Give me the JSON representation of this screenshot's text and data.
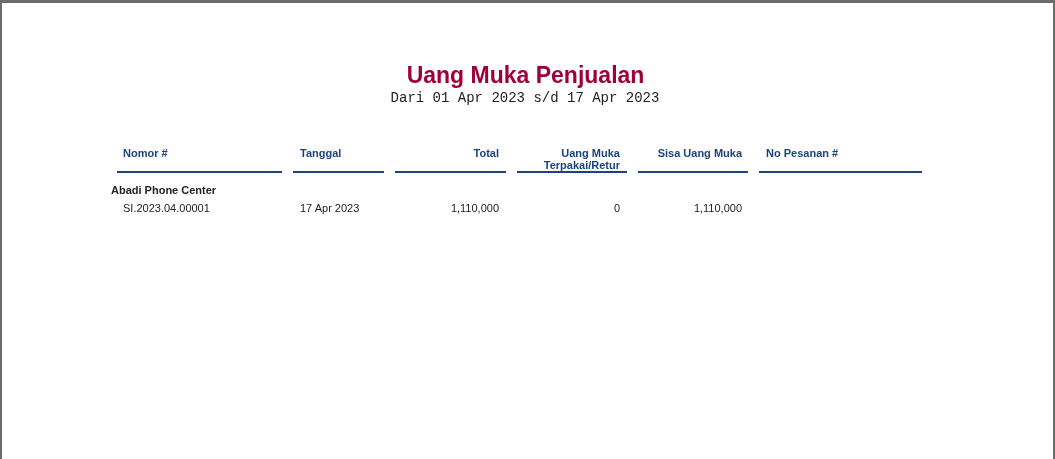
{
  "report": {
    "title": "Uang Muka Penjualan",
    "period": "Dari 01 Apr 2023 s/d 17 Apr 2023"
  },
  "table": {
    "columns": [
      {
        "lines": [
          "Nomor #"
        ],
        "kind": "text"
      },
      {
        "lines": [
          "Tanggal"
        ],
        "kind": "text"
      },
      {
        "lines": [
          "Total"
        ],
        "kind": "number"
      },
      {
        "lines": [
          "Uang Muka",
          "Terpakai/Retur"
        ],
        "kind": "number"
      },
      {
        "lines": [
          "Sisa Uang Muka"
        ],
        "kind": "number"
      },
      {
        "lines": [
          "No Pesanan #"
        ],
        "kind": "text"
      }
    ],
    "groups": [
      {
        "name": "Abadi Phone Center",
        "rows": [
          {
            "cells": [
              "SI.2023.04.00001",
              "17 Apr 2023",
              "1,110,000",
              "0",
              "1,110,000"
            ]
          }
        ]
      }
    ]
  }
}
